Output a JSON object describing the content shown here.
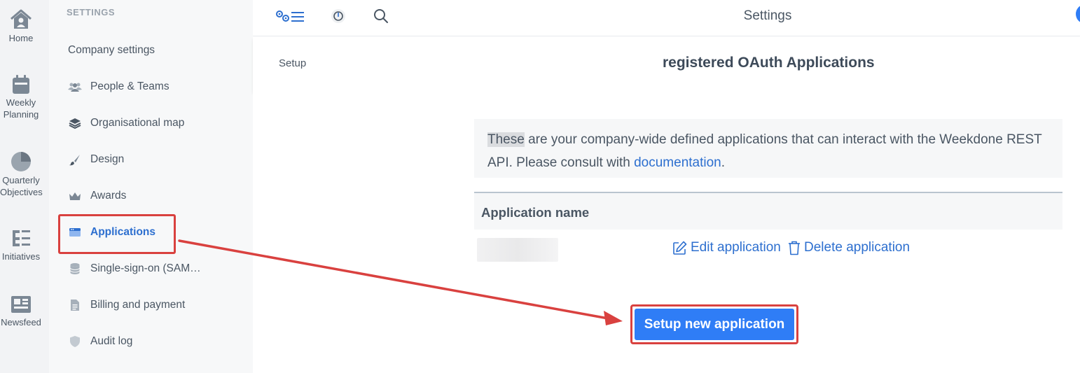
{
  "leftnav": {
    "items": [
      {
        "label": "Home",
        "icon": "home-icon"
      },
      {
        "label": "Weekly Planning",
        "icon": "calendar-icon"
      },
      {
        "label": "Quarterly Objectives",
        "icon": "pie-chart-icon"
      },
      {
        "label": "Initiatives",
        "icon": "tree-list-icon"
      },
      {
        "label": "Newsfeed",
        "icon": "newspaper-icon"
      }
    ]
  },
  "sidebar": {
    "heading": "SETTINGS",
    "items": [
      {
        "label": "Company settings",
        "icon": ""
      },
      {
        "label": "People & Teams",
        "icon": "people-icon"
      },
      {
        "label": "Organisational map",
        "icon": "layers-icon"
      },
      {
        "label": "Design",
        "icon": "brush-icon"
      },
      {
        "label": "Awards",
        "icon": "crown-icon"
      },
      {
        "label": "Applications",
        "icon": "window-icon",
        "active": true
      },
      {
        "label": "Single-sign-on (SAM…",
        "icon": "database-icon"
      },
      {
        "label": "Billing and payment",
        "icon": "document-icon"
      },
      {
        "label": "Audit log",
        "icon": "shield-icon"
      }
    ]
  },
  "topbar": {
    "title": "Settings",
    "icons": [
      "settings-menu-icon",
      "power-icon",
      "search-icon"
    ]
  },
  "subbar": {
    "breadcrumb": "Setup",
    "heading": "registered OAuth Applications"
  },
  "main": {
    "info_highlight": "These",
    "info_text_1": " are your company-wide defined applications that can interact with the Weekdone REST API. Please consult with ",
    "info_link": "documentation",
    "info_text_2": ".",
    "table_header": "Application name",
    "edit_label": "Edit application",
    "delete_label": "Delete application",
    "cta_label": "Setup new application"
  },
  "colors": {
    "accent": "#2f7df6",
    "link": "#2d6fcf",
    "annotation_red": "#d9413f"
  }
}
